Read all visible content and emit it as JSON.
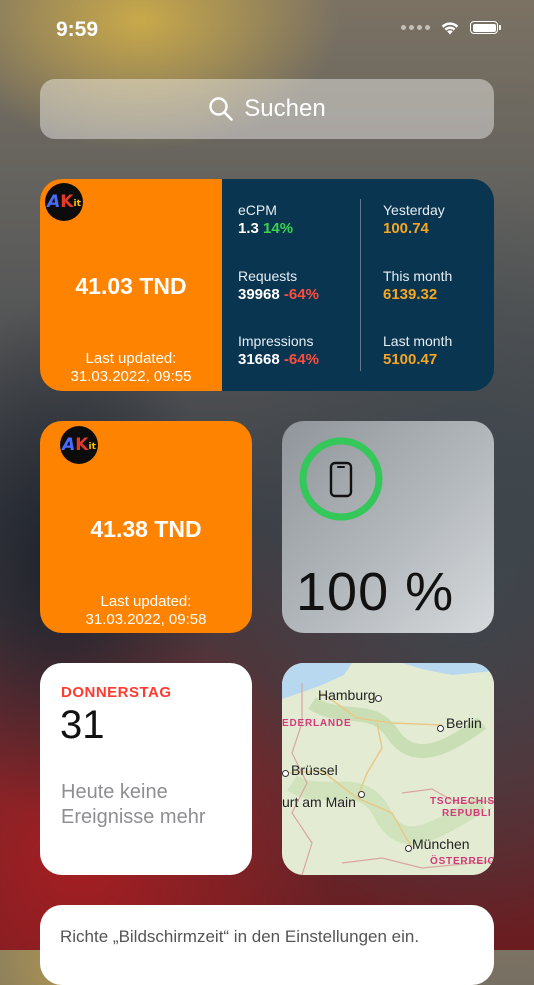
{
  "status_bar": {
    "time": "9:59"
  },
  "search": {
    "label": "Suchen"
  },
  "widget_wide": {
    "logo": {
      "a": "A",
      "k": "K",
      "it": "it"
    },
    "amount": "41.03 TND",
    "updated_label": "Last updated:",
    "updated_value": "31.03.2022, 09:55",
    "stats": {
      "ecpm": {
        "label": "eCPM",
        "value": "1.3",
        "change": "14%"
      },
      "requests": {
        "label": "Requests",
        "value": "39968",
        "change": "-64%"
      },
      "impressions": {
        "label": "Impressions",
        "value": "31668",
        "change": "-64%"
      },
      "yesterday": {
        "label": "Yesterday",
        "value": "100.74"
      },
      "this_month": {
        "label": "This month",
        "value": "6139.32"
      },
      "last_month": {
        "label": "Last month",
        "value": "5100.47"
      }
    },
    "colors": {
      "orange": "#fd8300",
      "navy": "#0a3550",
      "green": "#39d34f",
      "red": "#ff4d3d",
      "gold": "#f5a623"
    }
  },
  "widget_small": {
    "logo": {
      "a": "A",
      "k": "K",
      "it": "it"
    },
    "amount": "41.38 TND",
    "updated_label": "Last updated:",
    "updated_value": "31.03.2022, 09:58"
  },
  "widget_battery": {
    "percent_text": "100 %",
    "level": 1.0,
    "ring_color": "#34c759",
    "icon": "iphone-icon"
  },
  "widget_calendar": {
    "weekday": "DONNERSTAG",
    "day": "31",
    "note_line1": "Heute keine",
    "note_line2": "Ereignisse mehr"
  },
  "widget_map": {
    "cities": {
      "hamburg": "Hamburg",
      "berlin": "Berlin",
      "bruessel": "Brüssel",
      "frankfurt": "urt am Main",
      "muenchen": "München"
    },
    "countries": {
      "nederland": "EDERLANDE",
      "tschechien1": "TSCHECHIS",
      "tschechien2": "REPUBLI",
      "oesterreich": "ÖSTERREIC"
    }
  },
  "bottom_card": {
    "text": "Richte „Bildschirmzeit“ in den Einstellungen ein."
  }
}
